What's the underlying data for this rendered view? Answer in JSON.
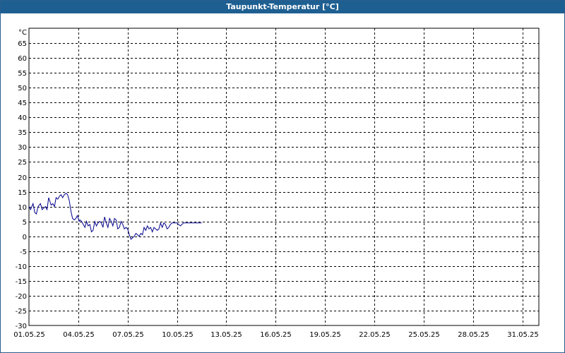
{
  "window": {
    "title": "Taupunkt-Temperatur [°C]"
  },
  "colors": {
    "titlebar": "#1e5f92",
    "series": "#00008b",
    "grid": "#000000"
  },
  "chart_data": {
    "type": "line",
    "title": "Taupunkt-Temperatur [°C]",
    "unit_label": "°C",
    "ylabel": "",
    "xlabel": "",
    "ylim": [
      -30,
      70
    ],
    "yticks": [
      65,
      60,
      55,
      50,
      45,
      40,
      35,
      30,
      25,
      20,
      15,
      10,
      5,
      0,
      -5,
      -10,
      -15,
      -20,
      -25,
      -30
    ],
    "xlim_days": [
      1,
      32
    ],
    "xticks": [
      "01.05.25",
      "04.05.25",
      "07.05.25",
      "10.05.25",
      "13.05.25",
      "16.05.25",
      "19.05.25",
      "22.05.25",
      "25.05.25",
      "28.05.25",
      "31.05.25"
    ],
    "xtick_days": [
      1,
      4,
      7,
      10,
      13,
      16,
      19,
      22,
      25,
      28,
      31
    ],
    "grid": true,
    "grid_style": "dashed",
    "legend": "none",
    "series": [
      {
        "color": "#00008b",
        "x": [
          1.0,
          1.1,
          1.25,
          1.35,
          1.45,
          1.55,
          1.7,
          1.8,
          1.9,
          2.0,
          2.1,
          2.2,
          2.35,
          2.45,
          2.55,
          2.65,
          2.75,
          2.85,
          2.95,
          3.05,
          3.15,
          3.25,
          3.35,
          3.45,
          3.55,
          3.65,
          3.75,
          3.85,
          3.95,
          4.0,
          4.05,
          4.1,
          4.2,
          4.3,
          4.4,
          4.5,
          4.6,
          4.7,
          4.8,
          4.9,
          5.0,
          5.1,
          5.2,
          5.3,
          5.4,
          5.5,
          5.6,
          5.7,
          5.8,
          5.9,
          6.0,
          6.1,
          6.2,
          6.3,
          6.4,
          6.5,
          6.6,
          6.7,
          6.8,
          6.9,
          7.0,
          7.1,
          7.2,
          7.3,
          7.4,
          7.5,
          7.6,
          7.7,
          7.8,
          7.9,
          8.0,
          8.1,
          8.2,
          8.3,
          8.4,
          8.5,
          8.6,
          8.7,
          8.8,
          8.9,
          9.0,
          9.1,
          9.2,
          9.3,
          9.4,
          9.5,
          9.6,
          9.7,
          9.8,
          9.9,
          10.0,
          10.1,
          10.2,
          10.3,
          10.4,
          10.5,
          10.6,
          10.7,
          10.8,
          10.9,
          11.0,
          11.1,
          11.2,
          11.3,
          11.4,
          11.5
        ],
        "y": [
          10,
          9,
          11,
          8,
          7.5,
          10,
          11,
          9,
          9.5,
          10,
          9,
          13,
          10.5,
          11,
          10,
          13,
          12.5,
          13.5,
          14,
          13,
          14,
          14.5,
          14,
          12,
          8.5,
          6,
          5.5,
          6,
          7,
          6,
          5,
          5.5,
          5,
          4,
          3,
          5,
          3.5,
          4,
          1.5,
          2,
          5,
          3.5,
          4.5,
          5,
          4.5,
          3,
          6.5,
          4.5,
          3,
          6,
          5,
          3.5,
          6,
          5.5,
          2.5,
          3,
          5,
          4,
          2.5,
          3,
          2.5,
          0.5,
          -1,
          -0.5,
          0,
          1,
          0.5,
          0,
          1,
          0.5,
          3,
          2,
          3.5,
          2.5,
          3,
          1.5,
          3,
          2.5,
          2,
          2.5,
          4.5,
          3,
          4.5,
          4,
          2.5,
          3,
          4,
          4.5,
          4.5,
          4.5,
          4.5,
          4,
          3.5,
          4,
          4.5,
          4.5,
          4.5,
          4.5,
          4.5,
          4.5,
          4.5,
          4.5,
          4.5,
          4.5,
          4.5,
          4.5
        ]
      }
    ]
  }
}
